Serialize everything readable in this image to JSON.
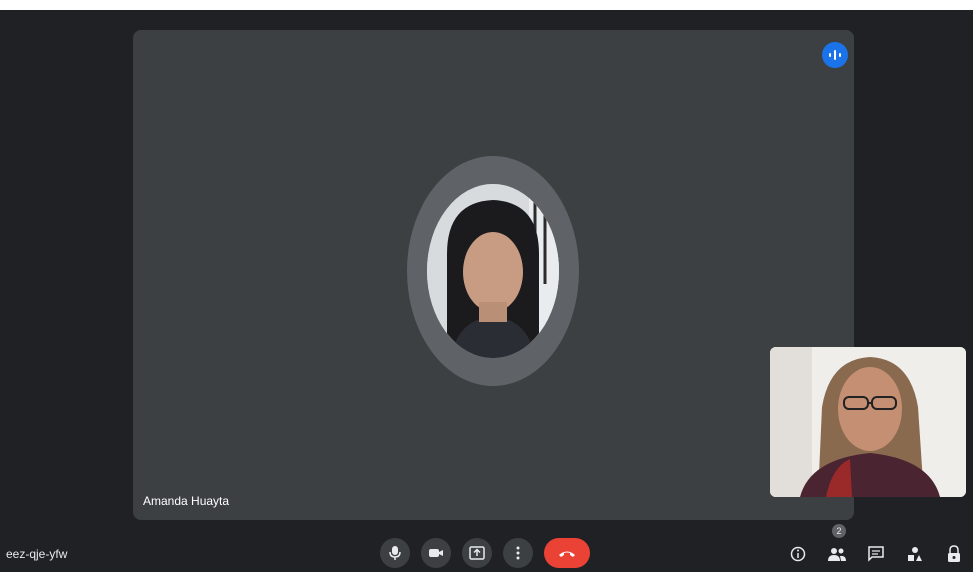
{
  "main_participant": {
    "name": "Amanda Huayta"
  },
  "meeting": {
    "code": "eez-qje-yfw"
  },
  "controls": [
    {
      "name": "microphone-icon"
    },
    {
      "name": "camera-icon"
    },
    {
      "name": "present-screen-icon"
    },
    {
      "name": "more-options-icon"
    },
    {
      "name": "end-call-icon"
    }
  ],
  "side_controls": [
    {
      "name": "info-icon"
    },
    {
      "name": "people-icon",
      "badge": "2"
    },
    {
      "name": "chat-icon"
    },
    {
      "name": "activities-icon"
    },
    {
      "name": "host-controls-icon"
    }
  ],
  "colors": {
    "background": "#202124",
    "tile": "#3c4043",
    "accent": "#1a73e8",
    "end_call": "#ea4335"
  }
}
